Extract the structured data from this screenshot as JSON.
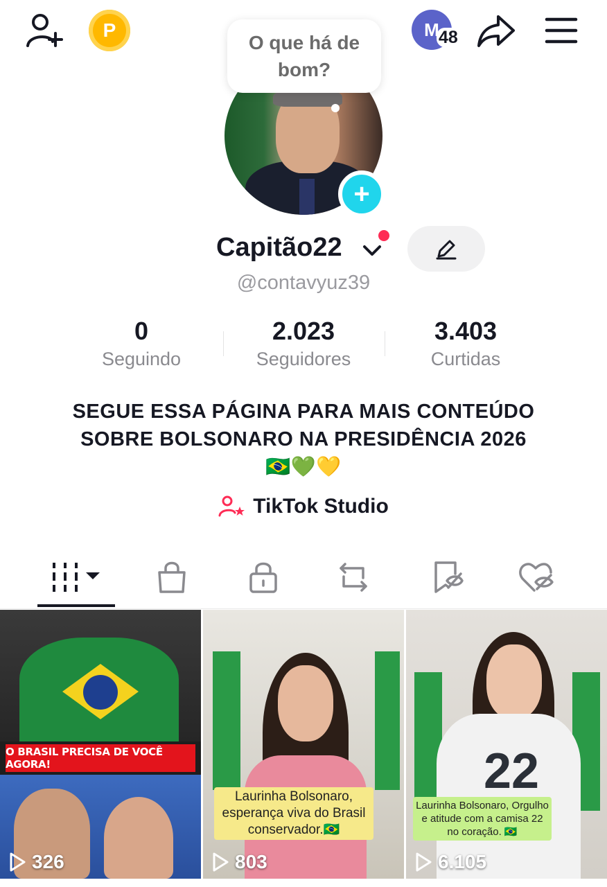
{
  "header": {
    "notification_count": "48",
    "avatar_initial": "M",
    "coin_letter": "P"
  },
  "bubble": {
    "text": "O que há de bom?"
  },
  "profile": {
    "username": "Capitão22",
    "handle": "@contavyuz39",
    "bio": "SEGUE ESSA PÁGINA PARA MAIS CONTEÚDO SOBRE BOLSONARO NA PRESIDÊNCIA 2026🇧🇷💚💛"
  },
  "stats": [
    {
      "value": "0",
      "label": "Seguindo"
    },
    {
      "value": "2.023",
      "label": "Seguidores"
    },
    {
      "value": "3.403",
      "label": "Curtidas"
    }
  ],
  "studio": {
    "label": "TikTok Studio"
  },
  "tabs": [
    "videos-grid",
    "shop",
    "private",
    "reposts",
    "favorites",
    "liked"
  ],
  "videos": [
    {
      "banner": "O BRASIL PRECISA DE VOCÊ AGORA!",
      "views": "326"
    },
    {
      "caption": "Laurinha Bolsonaro, esperança viva do Brasil conservador.🇧🇷",
      "views": "803"
    },
    {
      "number": "22",
      "caption": "Laurinha Bolsonaro, Orgulho e atitude com a camisa 22 no coração. 🇧🇷",
      "views": "6.105"
    }
  ],
  "colors": {
    "accent": "#fe2c55",
    "cyan": "#20d5ec",
    "text": "#161823",
    "muted": "#8a8a8f"
  }
}
